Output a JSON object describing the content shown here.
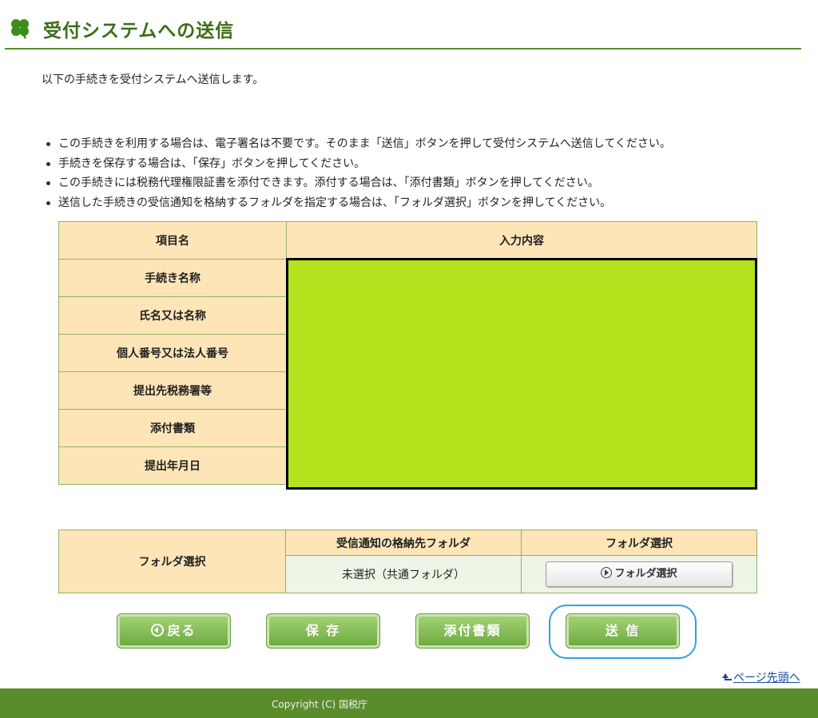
{
  "header": {
    "title": "受付システムへの送信"
  },
  "intro": "以下の手続きを受付システムへ送信します。",
  "bullets": [
    "この手続きを利用する場合は、電子署名は不要です。そのまま「送信」ボタンを押して受付システムへ送信してください。",
    "手続きを保存する場合は、「保存」ボタンを押してください。",
    "この手続きには税務代理権限証書を添付できます。添付する場合は、「添付書類」ボタンを押してください。",
    "送信した手続きの受信通知を格納するフォルダを指定する場合は、「フォルダ選択」ボタンを押してください。"
  ],
  "info_table": {
    "headers": [
      "項目名",
      "入力内容"
    ],
    "rows": [
      "手続き名称",
      "氏名又は名称",
      "個人番号又は法人番号",
      "提出先税務署等",
      "添付書類",
      "提出年月日"
    ]
  },
  "folder_table": {
    "label": "フォルダ選択",
    "col1_header": "受信通知の格納先フォルダ",
    "col2_header": "フォルダ選択",
    "current_value": "未選択（共通フォルダ）",
    "button": "フォルダ選択"
  },
  "actions": {
    "back": "戻る",
    "save": "保 存",
    "attach": "添付書類",
    "send": "送 信"
  },
  "pagetop": "ページ先頭へ",
  "footer": {
    "copyright": "Copyright (C) 国税庁"
  },
  "colors": {
    "brand_green": "#5a8c2c",
    "table_header": "#fde5b8",
    "highlight": "#2aa3e6",
    "redaction": "#b4e31e"
  }
}
